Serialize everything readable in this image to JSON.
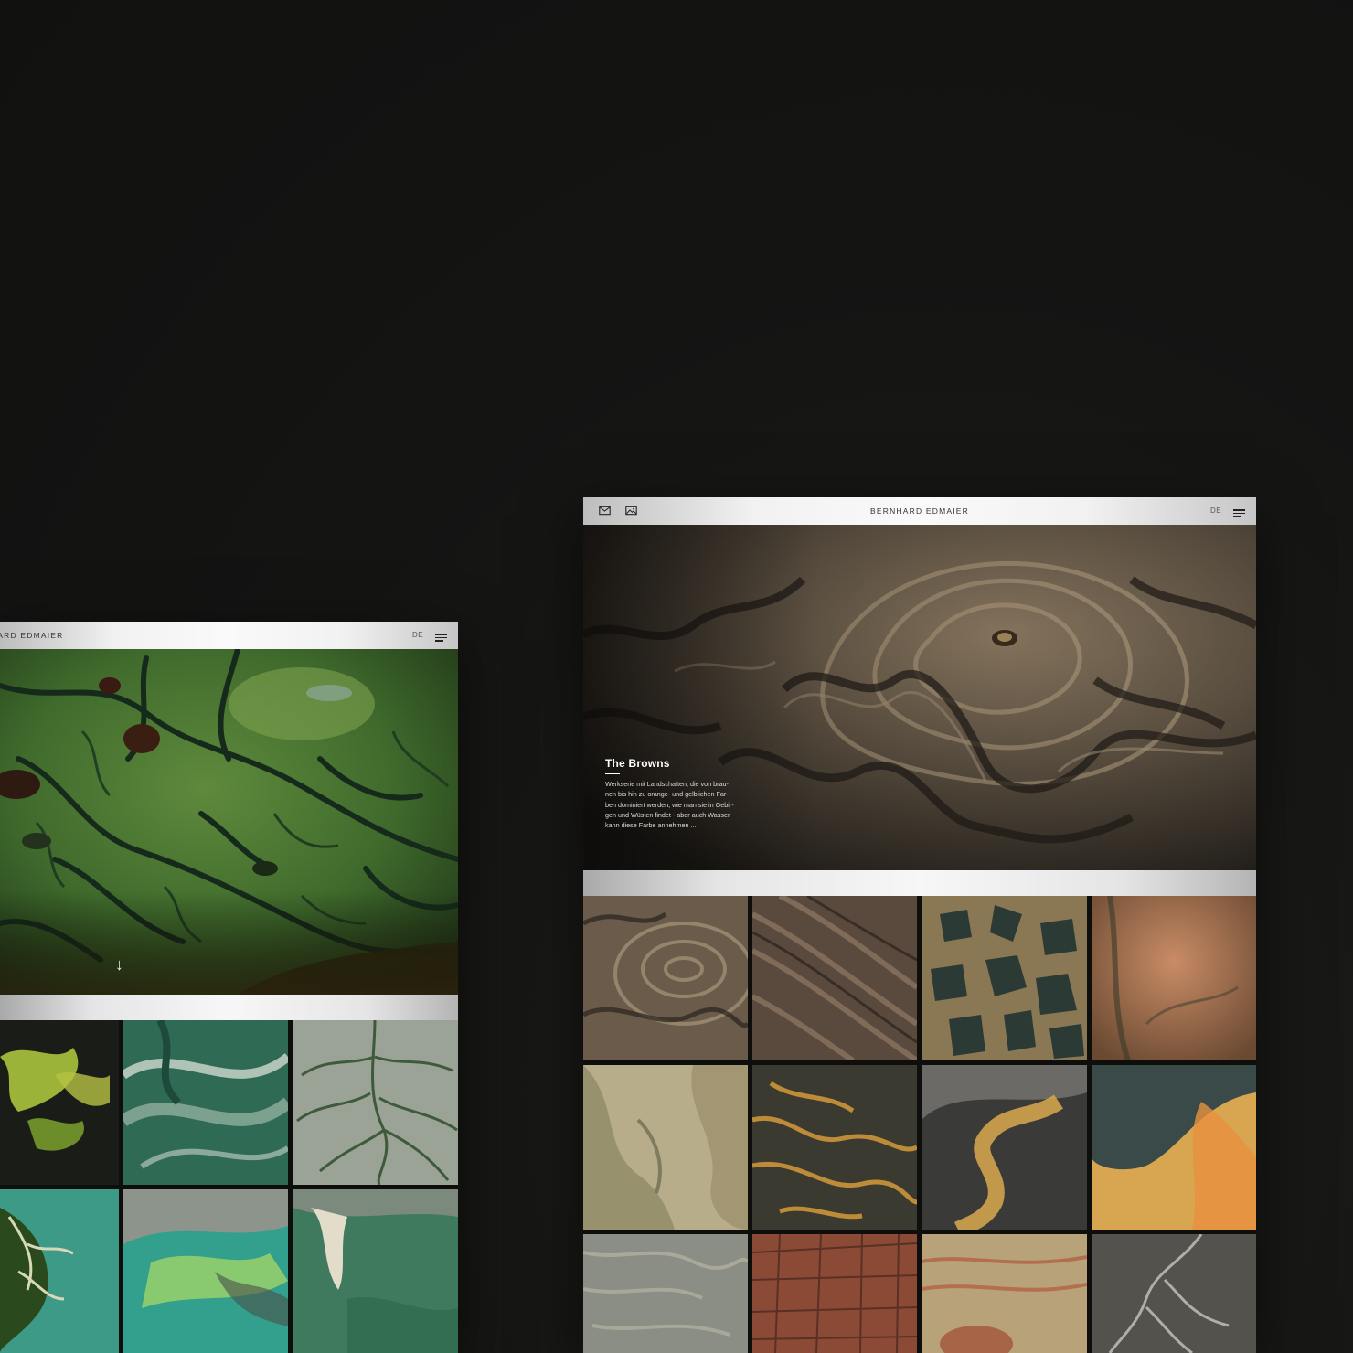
{
  "left_screen": {
    "header": {
      "brand": "BERNHARD EDMAIER",
      "lang": "DE",
      "menu_icon": "hamburger-icon"
    },
    "hero": {
      "scroll_icon": "arrow-down-icon",
      "scroll_glyph": "↓"
    },
    "gallery_tiles": 6
  },
  "right_screen": {
    "header": {
      "brand": "BERNHARD EDMAIER",
      "lang": "DE",
      "mail_icon": "mail-icon",
      "image_icon": "image-icon",
      "menu_icon": "hamburger-icon"
    },
    "hero": {
      "title": "The Browns",
      "text_lines": [
        "Werkserie mit Landschaften, die von brau-",
        "nen bis hin zu orange- und gelblichen Far-",
        "ben dominiert werden, wie man sie in Gebir-",
        "gen und Wüsten findet - aber auch Wasser",
        "kann diese Farbe annehmen ..."
      ]
    },
    "gallery_tiles": 12
  },
  "colors": {
    "background": "#121211",
    "header_silver": "#f1f1f1",
    "text_dark": "#333333"
  }
}
